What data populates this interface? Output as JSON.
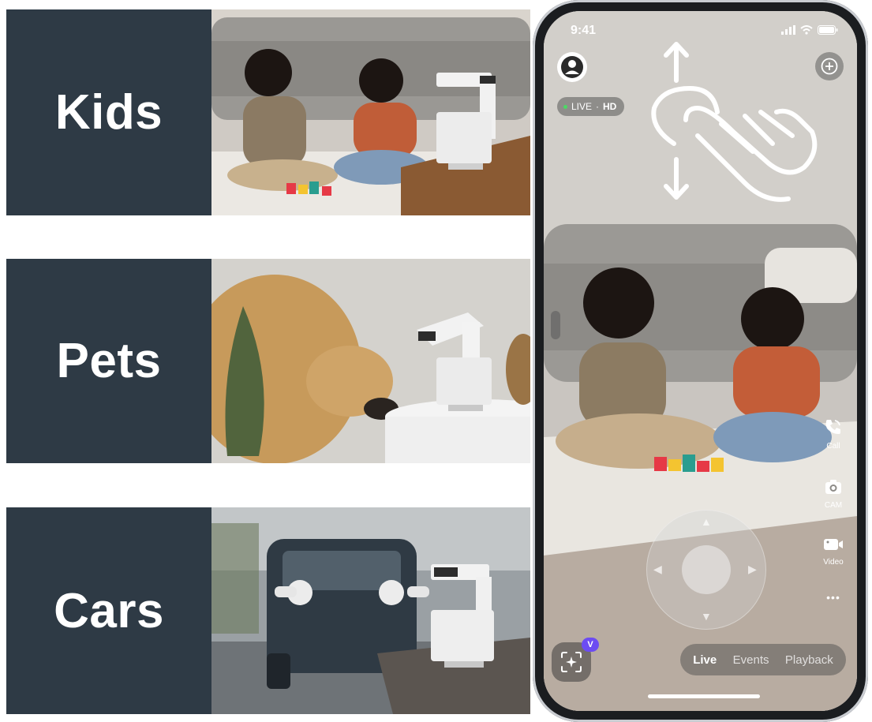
{
  "categories": [
    {
      "label": "Kids"
    },
    {
      "label": "Pets"
    },
    {
      "label": "Cars"
    }
  ],
  "phone": {
    "status": {
      "time": "9:41"
    },
    "live_badge": {
      "live": "LIVE",
      "separator": "·",
      "quality": "HD"
    },
    "actions": {
      "call": "Call",
      "cam": "CAM",
      "video": "Video",
      "more": "•••"
    },
    "ai_badge": "V",
    "tabs": {
      "live": "Live",
      "events": "Events",
      "playback": "Playback"
    },
    "active_tab": "Live",
    "colors": {
      "panel_bg": "#2e3a45",
      "badge_purple": "#6c4cf2",
      "live_dot": "#4cd964"
    }
  }
}
